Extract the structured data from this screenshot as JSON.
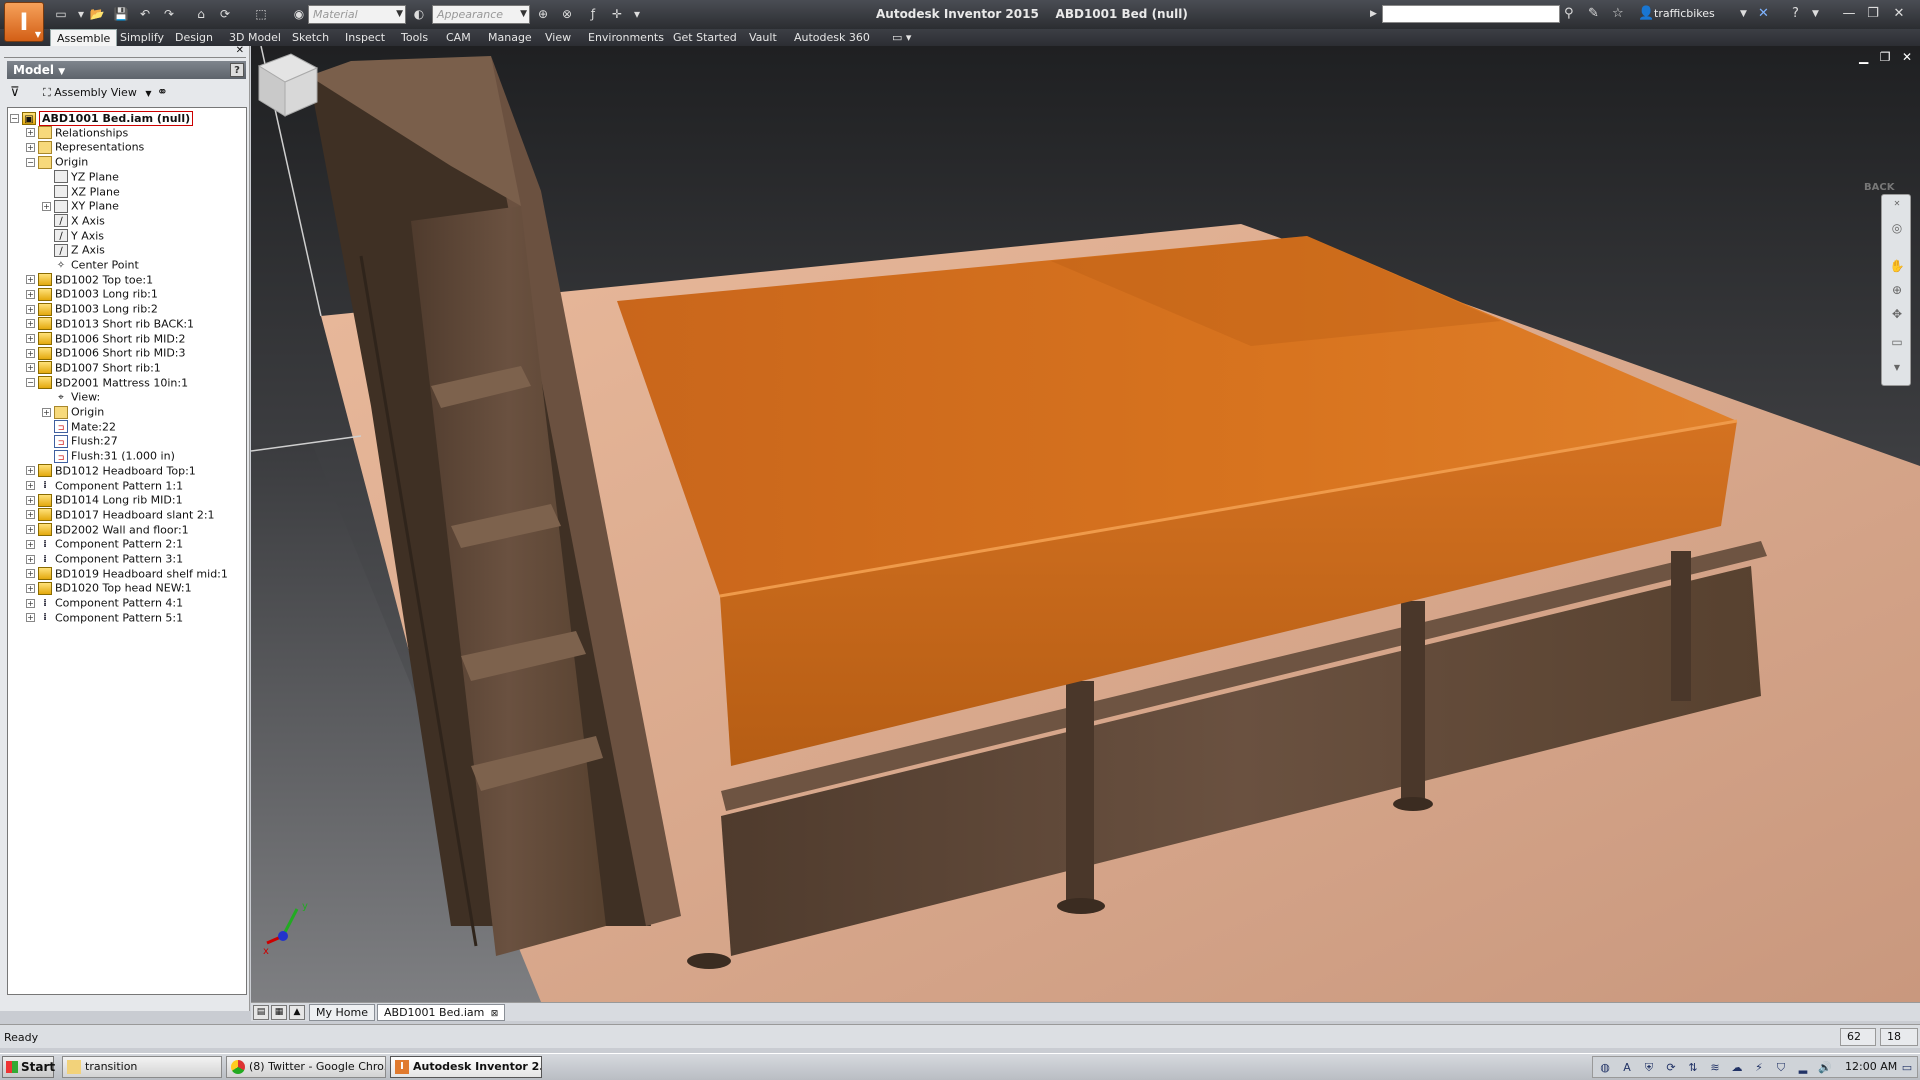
{
  "app": {
    "title": "Autodesk Inventor 2015",
    "document_title": "ABD1001 Bed (null)",
    "logo_letter": "I"
  },
  "quick_access": {
    "material_placeholder": "Material",
    "appearance_placeholder": "Appearance"
  },
  "user": {
    "name": "trafficbikes"
  },
  "ribbon_tabs": [
    "Assemble",
    "Simplify",
    "Design",
    "3D Model",
    "Sketch",
    "Inspect",
    "Tools",
    "CAM",
    "Manage",
    "View",
    "Environments",
    "Get Started",
    "Vault",
    "Autodesk 360"
  ],
  "browser": {
    "header": "Model",
    "view_mode": "Assembly View",
    "tree": [
      {
        "label": "ABD1001 Bed.iam (null)",
        "level": 0,
        "icon": "assembly",
        "exp": "-"
      },
      {
        "label": "Relationships",
        "level": 1,
        "icon": "folder",
        "exp": "+"
      },
      {
        "label": "Representations",
        "level": 1,
        "icon": "folder",
        "exp": "+"
      },
      {
        "label": "Origin",
        "level": 1,
        "icon": "folder",
        "exp": "-"
      },
      {
        "label": "YZ Plane",
        "level": 2,
        "icon": "plane",
        "exp": ""
      },
      {
        "label": "XZ Plane",
        "level": 2,
        "icon": "plane",
        "exp": ""
      },
      {
        "label": "XY Plane",
        "level": 2,
        "icon": "plane",
        "exp": "+"
      },
      {
        "label": "X Axis",
        "level": 2,
        "icon": "axis",
        "exp": ""
      },
      {
        "label": "Y Axis",
        "level": 2,
        "icon": "axis",
        "exp": ""
      },
      {
        "label": "Z Axis",
        "level": 2,
        "icon": "axis",
        "exp": ""
      },
      {
        "label": "Center Point",
        "level": 2,
        "icon": "point",
        "exp": ""
      },
      {
        "label": "BD1002 Top toe:1",
        "level": 1,
        "icon": "part",
        "exp": "+"
      },
      {
        "label": "BD1003 Long rib:1",
        "level": 1,
        "icon": "part",
        "exp": "+"
      },
      {
        "label": "BD1003 Long rib:2",
        "level": 1,
        "icon": "part",
        "exp": "+"
      },
      {
        "label": "BD1013 Short rib BACK:1",
        "level": 1,
        "icon": "part",
        "exp": "+"
      },
      {
        "label": "BD1006 Short rib MID:2",
        "level": 1,
        "icon": "part",
        "exp": "+"
      },
      {
        "label": "BD1006 Short rib MID:3",
        "level": 1,
        "icon": "part",
        "exp": "+"
      },
      {
        "label": "BD1007 Short rib:1",
        "level": 1,
        "icon": "part",
        "exp": "+"
      },
      {
        "label": "BD2001 Mattress 10in:1",
        "level": 1,
        "icon": "part",
        "exp": "-"
      },
      {
        "label": "View:",
        "level": 2,
        "icon": "view",
        "exp": ""
      },
      {
        "label": "Origin",
        "level": 2,
        "icon": "folder",
        "exp": "+"
      },
      {
        "label": "Mate:22",
        "level": 2,
        "icon": "constraint",
        "exp": ""
      },
      {
        "label": "Flush:27",
        "level": 2,
        "icon": "constraint",
        "exp": ""
      },
      {
        "label": "Flush:31 (1.000 in)",
        "level": 2,
        "icon": "constraint",
        "exp": ""
      },
      {
        "label": "BD1012 Headboard Top:1",
        "level": 1,
        "icon": "part",
        "exp": "+"
      },
      {
        "label": "Component Pattern 1:1",
        "level": 1,
        "icon": "pattern",
        "exp": "+"
      },
      {
        "label": "BD1014 Long rib MID:1",
        "level": 1,
        "icon": "part",
        "exp": "+"
      },
      {
        "label": "BD1017 Headboard slant 2:1",
        "level": 1,
        "icon": "part",
        "exp": "+"
      },
      {
        "label": "BD2002 Wall and floor:1",
        "level": 1,
        "icon": "part",
        "exp": "+"
      },
      {
        "label": "Component Pattern 2:1",
        "level": 1,
        "icon": "pattern",
        "exp": "+"
      },
      {
        "label": "Component Pattern 3:1",
        "level": 1,
        "icon": "pattern",
        "exp": "+"
      },
      {
        "label": "BD1019 Headboard shelf mid:1",
        "level": 1,
        "icon": "part",
        "exp": "+"
      },
      {
        "label": "BD1020 Top head NEW:1",
        "level": 1,
        "icon": "part",
        "exp": "+"
      },
      {
        "label": "Component Pattern 4:1",
        "level": 1,
        "icon": "pattern",
        "exp": "+"
      },
      {
        "label": "Component Pattern 5:1",
        "level": 1,
        "icon": "pattern",
        "exp": "+"
      }
    ]
  },
  "viewport": {
    "viewcube_label": "BACK",
    "triad": {
      "x": "x",
      "y": "y"
    },
    "colors": {
      "mattress": "#d9731f",
      "wood": "#5e4635",
      "floor": "#e8b493"
    }
  },
  "doc_tabs": [
    "My Home",
    "ABD1001 Bed.iam"
  ],
  "status": {
    "text": "Ready",
    "field1": "62",
    "field2": "18"
  },
  "taskbar": {
    "start": "Start",
    "tasks": [
      "transition",
      "(8) Twitter - Google Chro...",
      "Autodesk Inventor 2..."
    ],
    "clock": "12:00 AM"
  }
}
